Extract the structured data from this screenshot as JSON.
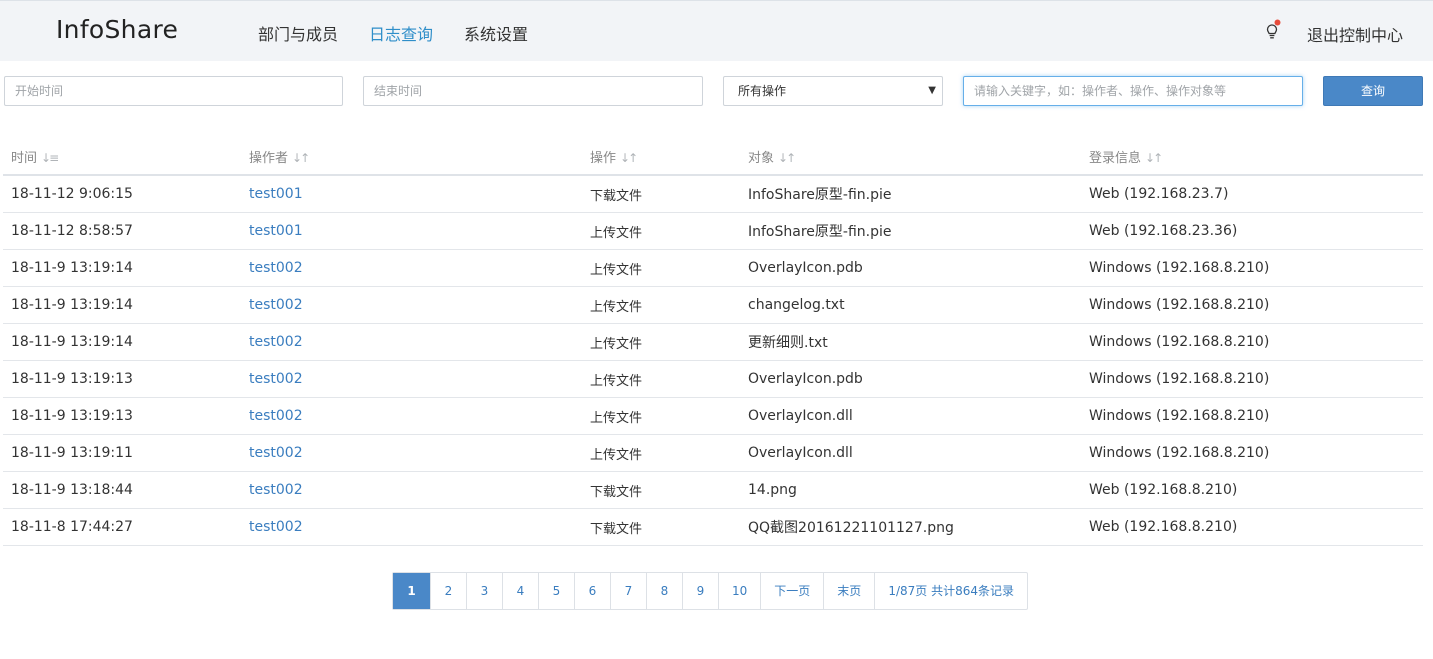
{
  "app": {
    "brand": "InfoShare"
  },
  "nav": {
    "items": [
      {
        "label": "部门与成员",
        "active": false
      },
      {
        "label": "日志查询",
        "active": true
      },
      {
        "label": "系统设置",
        "active": false
      }
    ],
    "logout": "退出控制中心"
  },
  "filters": {
    "start_placeholder": "开始时间",
    "end_placeholder": "结束时间",
    "operation_selected": "所有操作",
    "keyword_placeholder": "请输入关键字，如：操作者、操作、操作对象等",
    "query_label": "查询"
  },
  "table": {
    "columns": [
      "时间",
      "操作者",
      "操作",
      "对象",
      "登录信息"
    ],
    "rows": [
      {
        "time": "18-11-12 9:06:15",
        "user": "test001",
        "action": "下载文件",
        "object": "InfoShare原型-fin.pie",
        "login": "Web (192.168.23.7)"
      },
      {
        "time": "18-11-12 8:58:57",
        "user": "test001",
        "action": "上传文件",
        "object": "InfoShare原型-fin.pie",
        "login": "Web (192.168.23.36)"
      },
      {
        "time": "18-11-9 13:19:14",
        "user": "test002",
        "action": "上传文件",
        "object": "OverlayIcon.pdb",
        "login": "Windows (192.168.8.210)"
      },
      {
        "time": "18-11-9 13:19:14",
        "user": "test002",
        "action": "上传文件",
        "object": "changelog.txt",
        "login": "Windows (192.168.8.210)"
      },
      {
        "time": "18-11-9 13:19:14",
        "user": "test002",
        "action": "上传文件",
        "object": "更新细则.txt",
        "login": "Windows (192.168.8.210)"
      },
      {
        "time": "18-11-9 13:19:13",
        "user": "test002",
        "action": "上传文件",
        "object": "OverlayIcon.pdb",
        "login": "Windows (192.168.8.210)"
      },
      {
        "time": "18-11-9 13:19:13",
        "user": "test002",
        "action": "上传文件",
        "object": "OverlayIcon.dll",
        "login": "Windows (192.168.8.210)"
      },
      {
        "time": "18-11-9 13:19:11",
        "user": "test002",
        "action": "上传文件",
        "object": "OverlayIcon.dll",
        "login": "Windows (192.168.8.210)"
      },
      {
        "time": "18-11-9 13:18:44",
        "user": "test002",
        "action": "下载文件",
        "object": "14.png",
        "login": "Web (192.168.8.210)"
      },
      {
        "time": "18-11-8 17:44:27",
        "user": "test002",
        "action": "下载文件",
        "object": "QQ截图20161221101127.png",
        "login": "Web (192.168.8.210)"
      }
    ]
  },
  "pagination": {
    "current": "1",
    "pages": [
      "1",
      "2",
      "3",
      "4",
      "5",
      "6",
      "7",
      "8",
      "9",
      "10"
    ],
    "next_label": "下一页",
    "last_label": "末页",
    "summary": "1/87页  共计864条记录"
  },
  "colors": {
    "accent": "#4a88c8",
    "link": "#3a7dbf",
    "nav_active": "#2f8ec9",
    "topbar_bg": "#f2f4f7",
    "notify_dot": "#e74c3c"
  },
  "icons": {
    "notify": "lightbulb-icon",
    "sort": "sort-icon",
    "dropdown": "caret-down-icon"
  }
}
